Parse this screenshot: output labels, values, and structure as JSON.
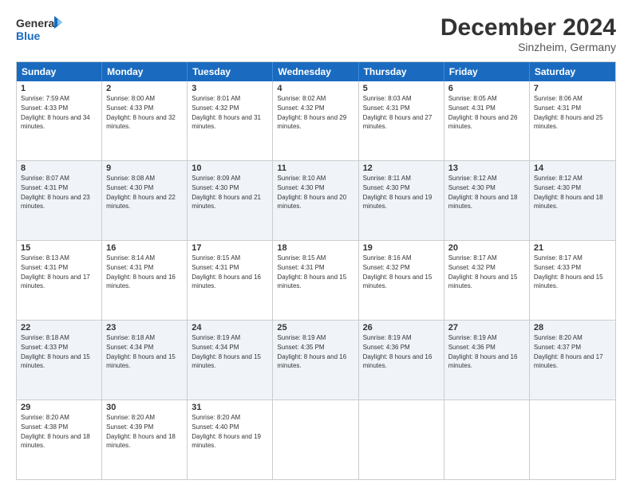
{
  "logo": {
    "line1": "General",
    "line2": "Blue"
  },
  "title": "December 2024",
  "subtitle": "Sinzheim, Germany",
  "days": [
    "Sunday",
    "Monday",
    "Tuesday",
    "Wednesday",
    "Thursday",
    "Friday",
    "Saturday"
  ],
  "weeks": [
    [
      {
        "day": "1",
        "sunrise": "Sunrise: 7:59 AM",
        "sunset": "Sunset: 4:33 PM",
        "daylight": "Daylight: 8 hours and 34 minutes."
      },
      {
        "day": "2",
        "sunrise": "Sunrise: 8:00 AM",
        "sunset": "Sunset: 4:33 PM",
        "daylight": "Daylight: 8 hours and 32 minutes."
      },
      {
        "day": "3",
        "sunrise": "Sunrise: 8:01 AM",
        "sunset": "Sunset: 4:32 PM",
        "daylight": "Daylight: 8 hours and 31 minutes."
      },
      {
        "day": "4",
        "sunrise": "Sunrise: 8:02 AM",
        "sunset": "Sunset: 4:32 PM",
        "daylight": "Daylight: 8 hours and 29 minutes."
      },
      {
        "day": "5",
        "sunrise": "Sunrise: 8:03 AM",
        "sunset": "Sunset: 4:31 PM",
        "daylight": "Daylight: 8 hours and 27 minutes."
      },
      {
        "day": "6",
        "sunrise": "Sunrise: 8:05 AM",
        "sunset": "Sunset: 4:31 PM",
        "daylight": "Daylight: 8 hours and 26 minutes."
      },
      {
        "day": "7",
        "sunrise": "Sunrise: 8:06 AM",
        "sunset": "Sunset: 4:31 PM",
        "daylight": "Daylight: 8 hours and 25 minutes."
      }
    ],
    [
      {
        "day": "8",
        "sunrise": "Sunrise: 8:07 AM",
        "sunset": "Sunset: 4:31 PM",
        "daylight": "Daylight: 8 hours and 23 minutes."
      },
      {
        "day": "9",
        "sunrise": "Sunrise: 8:08 AM",
        "sunset": "Sunset: 4:30 PM",
        "daylight": "Daylight: 8 hours and 22 minutes."
      },
      {
        "day": "10",
        "sunrise": "Sunrise: 8:09 AM",
        "sunset": "Sunset: 4:30 PM",
        "daylight": "Daylight: 8 hours and 21 minutes."
      },
      {
        "day": "11",
        "sunrise": "Sunrise: 8:10 AM",
        "sunset": "Sunset: 4:30 PM",
        "daylight": "Daylight: 8 hours and 20 minutes."
      },
      {
        "day": "12",
        "sunrise": "Sunrise: 8:11 AM",
        "sunset": "Sunset: 4:30 PM",
        "daylight": "Daylight: 8 hours and 19 minutes."
      },
      {
        "day": "13",
        "sunrise": "Sunrise: 8:12 AM",
        "sunset": "Sunset: 4:30 PM",
        "daylight": "Daylight: 8 hours and 18 minutes."
      },
      {
        "day": "14",
        "sunrise": "Sunrise: 8:12 AM",
        "sunset": "Sunset: 4:30 PM",
        "daylight": "Daylight: 8 hours and 18 minutes."
      }
    ],
    [
      {
        "day": "15",
        "sunrise": "Sunrise: 8:13 AM",
        "sunset": "Sunset: 4:31 PM",
        "daylight": "Daylight: 8 hours and 17 minutes."
      },
      {
        "day": "16",
        "sunrise": "Sunrise: 8:14 AM",
        "sunset": "Sunset: 4:31 PM",
        "daylight": "Daylight: 8 hours and 16 minutes."
      },
      {
        "day": "17",
        "sunrise": "Sunrise: 8:15 AM",
        "sunset": "Sunset: 4:31 PM",
        "daylight": "Daylight: 8 hours and 16 minutes."
      },
      {
        "day": "18",
        "sunrise": "Sunrise: 8:15 AM",
        "sunset": "Sunset: 4:31 PM",
        "daylight": "Daylight: 8 hours and 15 minutes."
      },
      {
        "day": "19",
        "sunrise": "Sunrise: 8:16 AM",
        "sunset": "Sunset: 4:32 PM",
        "daylight": "Daylight: 8 hours and 15 minutes."
      },
      {
        "day": "20",
        "sunrise": "Sunrise: 8:17 AM",
        "sunset": "Sunset: 4:32 PM",
        "daylight": "Daylight: 8 hours and 15 minutes."
      },
      {
        "day": "21",
        "sunrise": "Sunrise: 8:17 AM",
        "sunset": "Sunset: 4:33 PM",
        "daylight": "Daylight: 8 hours and 15 minutes."
      }
    ],
    [
      {
        "day": "22",
        "sunrise": "Sunrise: 8:18 AM",
        "sunset": "Sunset: 4:33 PM",
        "daylight": "Daylight: 8 hours and 15 minutes."
      },
      {
        "day": "23",
        "sunrise": "Sunrise: 8:18 AM",
        "sunset": "Sunset: 4:34 PM",
        "daylight": "Daylight: 8 hours and 15 minutes."
      },
      {
        "day": "24",
        "sunrise": "Sunrise: 8:19 AM",
        "sunset": "Sunset: 4:34 PM",
        "daylight": "Daylight: 8 hours and 15 minutes."
      },
      {
        "day": "25",
        "sunrise": "Sunrise: 8:19 AM",
        "sunset": "Sunset: 4:35 PM",
        "daylight": "Daylight: 8 hours and 16 minutes."
      },
      {
        "day": "26",
        "sunrise": "Sunrise: 8:19 AM",
        "sunset": "Sunset: 4:36 PM",
        "daylight": "Daylight: 8 hours and 16 minutes."
      },
      {
        "day": "27",
        "sunrise": "Sunrise: 8:19 AM",
        "sunset": "Sunset: 4:36 PM",
        "daylight": "Daylight: 8 hours and 16 minutes."
      },
      {
        "day": "28",
        "sunrise": "Sunrise: 8:20 AM",
        "sunset": "Sunset: 4:37 PM",
        "daylight": "Daylight: 8 hours and 17 minutes."
      }
    ],
    [
      {
        "day": "29",
        "sunrise": "Sunrise: 8:20 AM",
        "sunset": "Sunset: 4:38 PM",
        "daylight": "Daylight: 8 hours and 18 minutes."
      },
      {
        "day": "30",
        "sunrise": "Sunrise: 8:20 AM",
        "sunset": "Sunset: 4:39 PM",
        "daylight": "Daylight: 8 hours and 18 minutes."
      },
      {
        "day": "31",
        "sunrise": "Sunrise: 8:20 AM",
        "sunset": "Sunset: 4:40 PM",
        "daylight": "Daylight: 8 hours and 19 minutes."
      },
      null,
      null,
      null,
      null
    ]
  ]
}
